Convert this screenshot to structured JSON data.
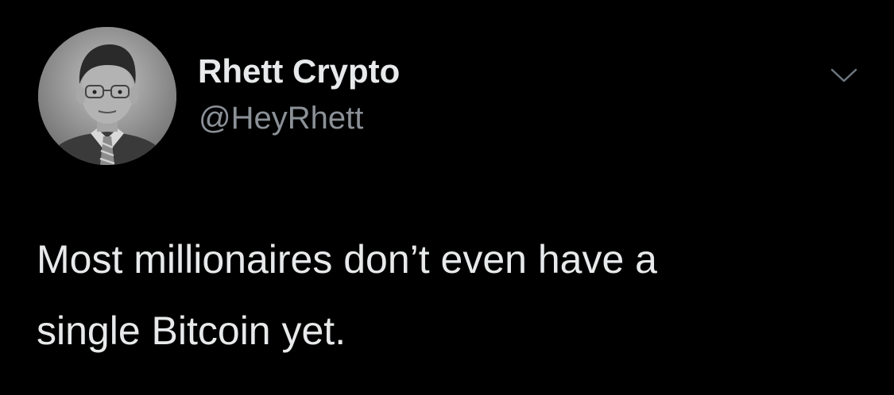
{
  "author": {
    "display_name": "Rhett Crypto",
    "handle": "@HeyRhett",
    "avatar_icon": "profile-photo"
  },
  "menu": {
    "icon": "chevron-down-icon"
  },
  "tweet": {
    "text": "Most millionaires don’t even have a\nsingle Bitcoin yet."
  },
  "colors": {
    "background": "#000000",
    "primary_text": "#e7e9ea",
    "secondary_text": "#8b9197"
  }
}
